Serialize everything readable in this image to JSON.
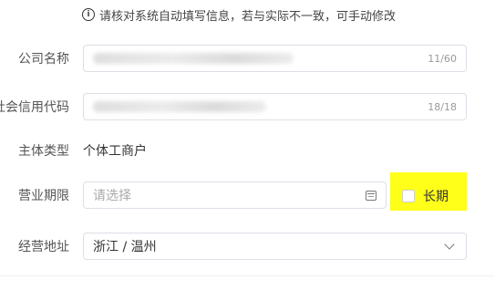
{
  "notice": {
    "icon": "info-icon",
    "text": "请核对系统自动填写信息，若与实际不一致，可手动修改"
  },
  "company_name": {
    "label": "公司名称",
    "counter": "11/60",
    "value_state": "blurred"
  },
  "credit_code": {
    "label": "社会信用代码",
    "counter": "18/18",
    "value_state": "blurred"
  },
  "entity_type": {
    "label": "主体类型",
    "value": "个体工商户"
  },
  "business_term": {
    "label": "营业期限",
    "placeholder": "请选择",
    "icon": "calendar-icon",
    "long_term_label": "长期",
    "long_term_checked": false,
    "highlight_color": "#ffff1a"
  },
  "address": {
    "label": "经营地址",
    "value": "浙江 / 温州",
    "icon": "chevron-down-icon"
  }
}
